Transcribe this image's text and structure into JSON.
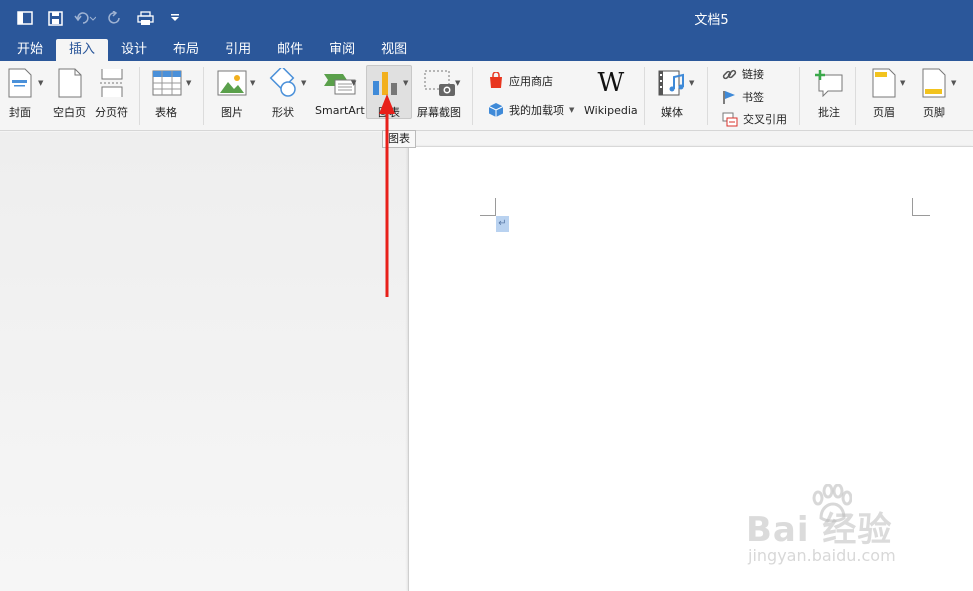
{
  "window": {
    "title": "文档5"
  },
  "tabs": [
    {
      "label": "开始"
    },
    {
      "label": "插入"
    },
    {
      "label": "设计"
    },
    {
      "label": "布局"
    },
    {
      "label": "引用"
    },
    {
      "label": "邮件"
    },
    {
      "label": "审阅"
    },
    {
      "label": "视图"
    }
  ],
  "active_tab": "插入",
  "ribbon": {
    "cover": "封面",
    "blank_page": "空白页",
    "page_break": "分页符",
    "table": "表格",
    "picture": "图片",
    "shape": "形状",
    "smartart": "SmartArt",
    "chart": "图表",
    "screenshot": "屏幕截图",
    "app_store": "应用商店",
    "my_addins": "我的加载项",
    "wikipedia": "Wikipedia",
    "wikipedia_logo": "W",
    "media": "媒体",
    "link": "链接",
    "bookmark": "书签",
    "cross_ref": "交叉引用",
    "comment": "批注",
    "header": "页眉",
    "footer": "页脚"
  },
  "tooltip": "图表",
  "document": {
    "paragraph_mark": "↵"
  },
  "watermark": {
    "main": "Bai 经验",
    "sub": "jingyan.baidu.com"
  },
  "colors": {
    "accent": "#2b579a",
    "arrow": "#e8201a"
  }
}
